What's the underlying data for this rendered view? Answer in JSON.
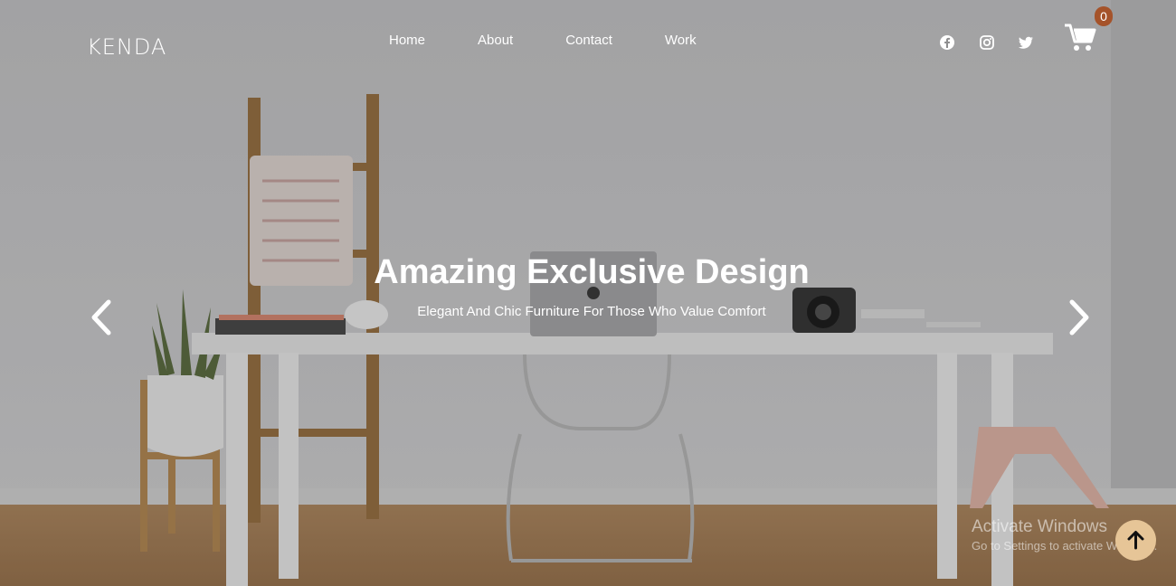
{
  "brand": {
    "logo": "KENDA"
  },
  "nav": {
    "links": [
      "Home",
      "About",
      "Contact",
      "Work"
    ]
  },
  "social": [
    "facebook-icon",
    "instagram-icon",
    "twitter-icon"
  ],
  "cart": {
    "count": "0",
    "icon": "cart-icon",
    "badge_color": "#a5532a"
  },
  "hero": {
    "title": "Amazing Exclusive Design",
    "subtitle": "Elegant And Chic Furniture For Those Who Value Comfort",
    "prev_icon": "chevron-left-icon",
    "next_icon": "chevron-right-icon"
  },
  "watermark": {
    "title": "Activate Windows",
    "subtitle": "Go to Settings to activate Windows."
  },
  "scroll_top": {
    "icon": "arrow-up-icon",
    "color": "#e6c597"
  }
}
